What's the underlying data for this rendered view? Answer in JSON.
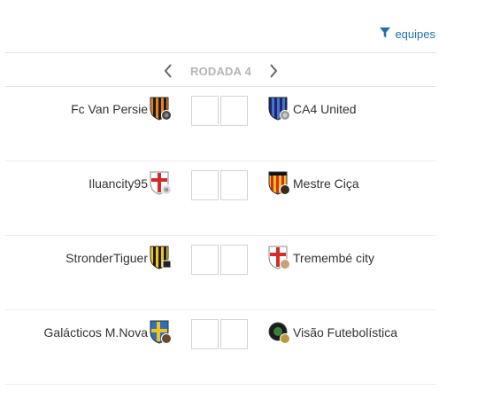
{
  "filter": {
    "label": "equipes",
    "icon": "filter-icon",
    "color": "#1f6fb5"
  },
  "round": {
    "label": "RODADA 4",
    "prev_icon": "chevron-left-icon",
    "next_icon": "chevron-right-icon"
  },
  "matches": [
    {
      "home": {
        "name": "Fc Van Persie",
        "crest": "orange-black-stripes-shield"
      },
      "away": {
        "name": "CA4 United",
        "crest": "navy-blue-stripes-shield"
      },
      "home_score": "",
      "away_score": ""
    },
    {
      "home": {
        "name": "Iluancity95",
        "crest": "white-red-cross-shield"
      },
      "away": {
        "name": "Mestre Ciça",
        "crest": "red-yellow-stripes-shield"
      },
      "home_score": "",
      "away_score": ""
    },
    {
      "home": {
        "name": "StronderTiguer",
        "crest": "yellow-black-stripes-shield"
      },
      "away": {
        "name": "Tremembé city",
        "crest": "white-red-cross-shield"
      },
      "home_score": "",
      "away_score": ""
    },
    {
      "home": {
        "name": "Galácticos M.Nova",
        "crest": "blue-yellow-cross-shield"
      },
      "away": {
        "name": "Visão Futebolística",
        "crest": "black-round-crest"
      },
      "home_score": "",
      "away_score": ""
    }
  ]
}
